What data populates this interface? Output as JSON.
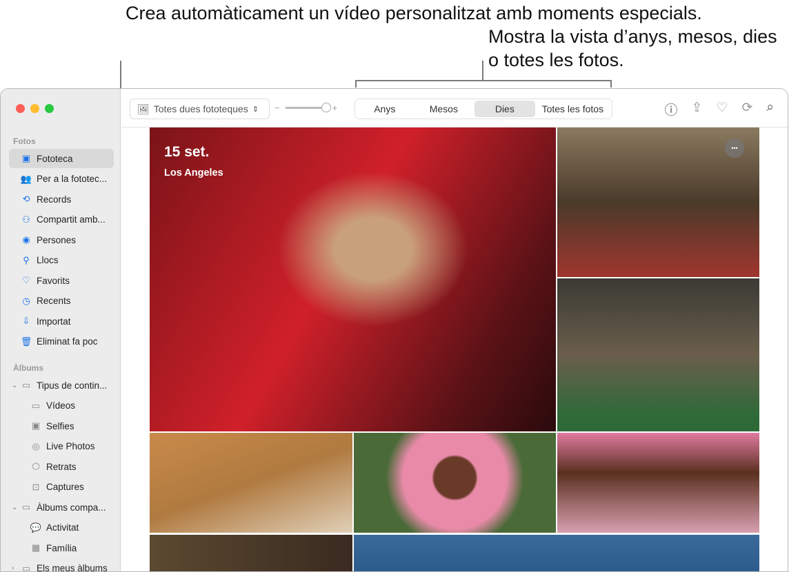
{
  "callouts": {
    "left": "Crea automàticament un vídeo personalitzat amb moments especials.",
    "right": "Mostra la vista d’anys, mesos, dies o totes les fotos."
  },
  "sidebar": {
    "section_fotos": "Fotos",
    "section_albums": "Àlbums",
    "items": [
      {
        "label": "Fototeca",
        "icon": "photo-library-icon"
      },
      {
        "label": "Per a la fototec...",
        "icon": "people-icon"
      },
      {
        "label": "Records",
        "icon": "memories-icon"
      },
      {
        "label": "Compartit amb...",
        "icon": "shared-icon"
      },
      {
        "label": "Persones",
        "icon": "person-icon"
      },
      {
        "label": "Llocs",
        "icon": "map-pin-icon"
      },
      {
        "label": "Favorits",
        "icon": "heart-icon"
      },
      {
        "label": "Recents",
        "icon": "clock-icon"
      },
      {
        "label": "Importat",
        "icon": "import-icon"
      },
      {
        "label": "Eliminat fa poc",
        "icon": "trash-icon"
      }
    ],
    "albums": [
      {
        "label": "Tipus de contin...",
        "icon": "folder-icon"
      },
      {
        "label": "Vídeos",
        "icon": "video-icon"
      },
      {
        "label": "Selfies",
        "icon": "selfie-icon"
      },
      {
        "label": "Live Photos",
        "icon": "live-photo-icon"
      },
      {
        "label": "Retrats",
        "icon": "cube-icon"
      },
      {
        "label": "Captures",
        "icon": "screenshot-icon"
      },
      {
        "label": "Àlbums compa...",
        "icon": "shared-album-icon"
      },
      {
        "label": "Activitat",
        "icon": "activity-icon"
      },
      {
        "label": "Família",
        "icon": "album-thumbnail-icon"
      },
      {
        "label": "Els meus àlbums",
        "icon": "folder-icon"
      }
    ]
  },
  "toolbar": {
    "library_select": "Totes dues fototeques",
    "zoom_minus": "−",
    "zoom_plus": "+",
    "zoom_level": 1.0,
    "tabs": [
      "Anys",
      "Mesos",
      "Dies",
      "Totes les fotos"
    ],
    "selected_tab": "Dies"
  },
  "main": {
    "date": "15 set.",
    "location": "Los Angeles",
    "more": "•••"
  },
  "colors": {
    "accent": "#1a73e8",
    "close": "#fe5f57",
    "minimize": "#febc2e",
    "zoom": "#28c840"
  }
}
